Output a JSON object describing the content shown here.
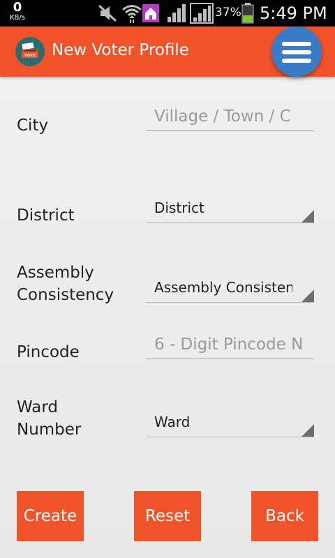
{
  "status_bar": {
    "data_rate": "0",
    "data_rate_unit": "KB/s",
    "battery_percent": "37%",
    "time": "5:49 PM",
    "icons": [
      "mute-icon",
      "wifi-icon",
      "home-icon",
      "signal-icon",
      "signal-icon",
      "battery-icon"
    ]
  },
  "app_bar": {
    "title": "New Voter Profile",
    "logo_text": "VOTE",
    "accent_color": "#f0532a",
    "menu_button_color": "#3a7bc8"
  },
  "form": {
    "city": {
      "label": "City",
      "placeholder": "Village / Town / C"
    },
    "district": {
      "label": "District",
      "selected": "District"
    },
    "assembly": {
      "label_line1": "Assembly",
      "label_line2": "Consistency",
      "selected": "Assembly Consistency"
    },
    "pincode": {
      "label": "Pincode",
      "placeholder": "6 - Digit Pincode N"
    },
    "ward": {
      "label_line1": "Ward",
      "label_line2": "Number",
      "selected": "Ward"
    }
  },
  "actions": {
    "create": "Create",
    "reset": "Reset",
    "back": "Back"
  }
}
